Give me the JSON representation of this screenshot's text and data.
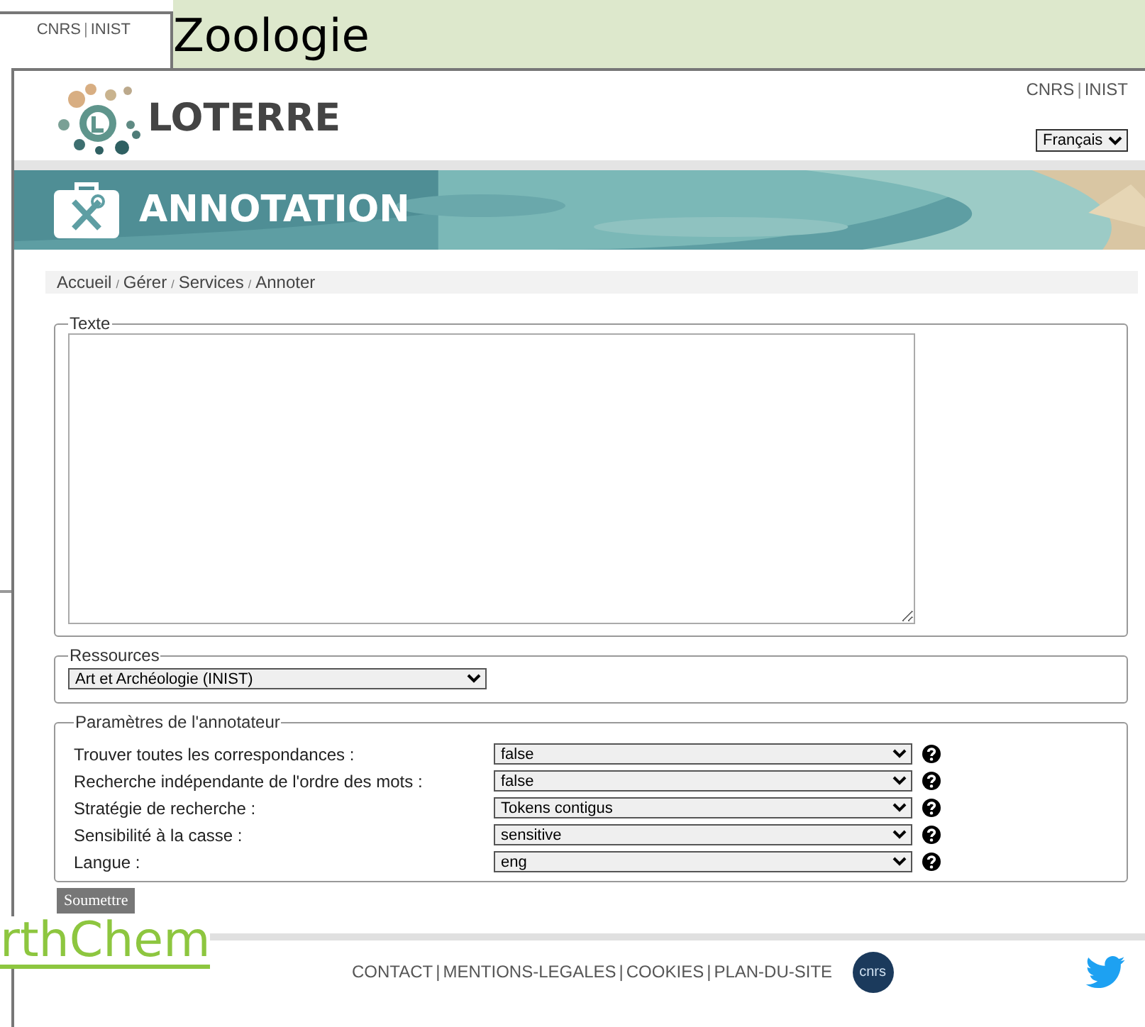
{
  "background": {
    "heading": "Zoologie",
    "side_window": {
      "links": [
        "CNRS",
        "INIST"
      ],
      "separator": "|"
    },
    "link": "rthChem"
  },
  "header": {
    "logo": "LOTERRE",
    "links": [
      "CNRS",
      "INIST"
    ],
    "separator": "|",
    "language": "Français"
  },
  "banner": {
    "title": "ANNOTATION"
  },
  "breadcrumb": [
    "Accueil",
    "Gérer",
    "Services",
    "Annoter"
  ],
  "breadcrumb_separator": "/",
  "text_section": {
    "legend": "Texte"
  },
  "resources": {
    "legend": "Ressources",
    "value": "Art et Archéologie (INIST)"
  },
  "parameters": {
    "legend": "Paramètres de l'annotateur",
    "rows": [
      {
        "label": "Trouver toutes les correspondances :",
        "value": "false"
      },
      {
        "label": "Recherche indépendante de l'ordre des mots :",
        "value": "false"
      },
      {
        "label": "Stratégie de recherche :",
        "value": "Tokens contigus"
      },
      {
        "label": "Sensibilité à la casse :",
        "value": "sensitive"
      },
      {
        "label": "Langue :",
        "value": "eng"
      }
    ]
  },
  "submit": "Soumettre",
  "footer": {
    "links": [
      "CONTACT",
      "MENTIONS-LEGALES",
      "COOKIES",
      "PLAN-DU-SITE"
    ],
    "separator": "|",
    "logo_text": "cnrs"
  }
}
